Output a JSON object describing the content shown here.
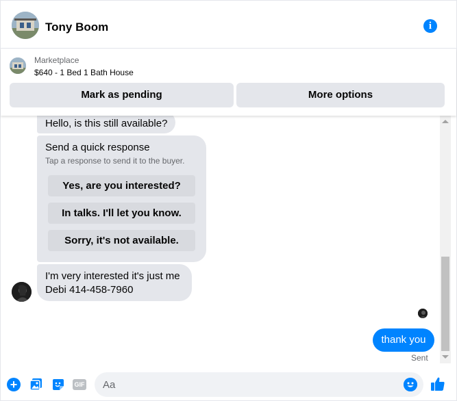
{
  "header": {
    "contact_name": "Tony Boom",
    "info_icon": "info-icon",
    "info_glyph": "i"
  },
  "marketplace": {
    "label": "Marketplace",
    "item": "$640 - 1 Bed 1 Bath House",
    "mark_pending_label": "Mark as pending",
    "more_options_label": "More options"
  },
  "messages": {
    "first_incoming": "Hello, is this still available?",
    "quick_response": {
      "title": "Send a quick response",
      "subtitle": "Tap a response to send it to the buyer.",
      "options": [
        "Yes, are you interested?",
        "In talks. I'll let you know.",
        "Sorry, it's not available."
      ]
    },
    "second_incoming_line1": "I'm very interested it's just me",
    "second_incoming_line2": "Debi 414-458-7960",
    "outgoing": "thank you",
    "status": "Sent"
  },
  "composer": {
    "placeholder": "Aa",
    "gif_label": "GIF",
    "plus_glyph": "+",
    "icons": [
      "plus-icon",
      "photo-icon",
      "sticker-icon",
      "gif-icon",
      "emoji-icon",
      "like-icon"
    ]
  },
  "colors": {
    "accent": "#0084ff",
    "bubble_incoming": "#e4e6eb",
    "muted_text": "#65676b"
  }
}
